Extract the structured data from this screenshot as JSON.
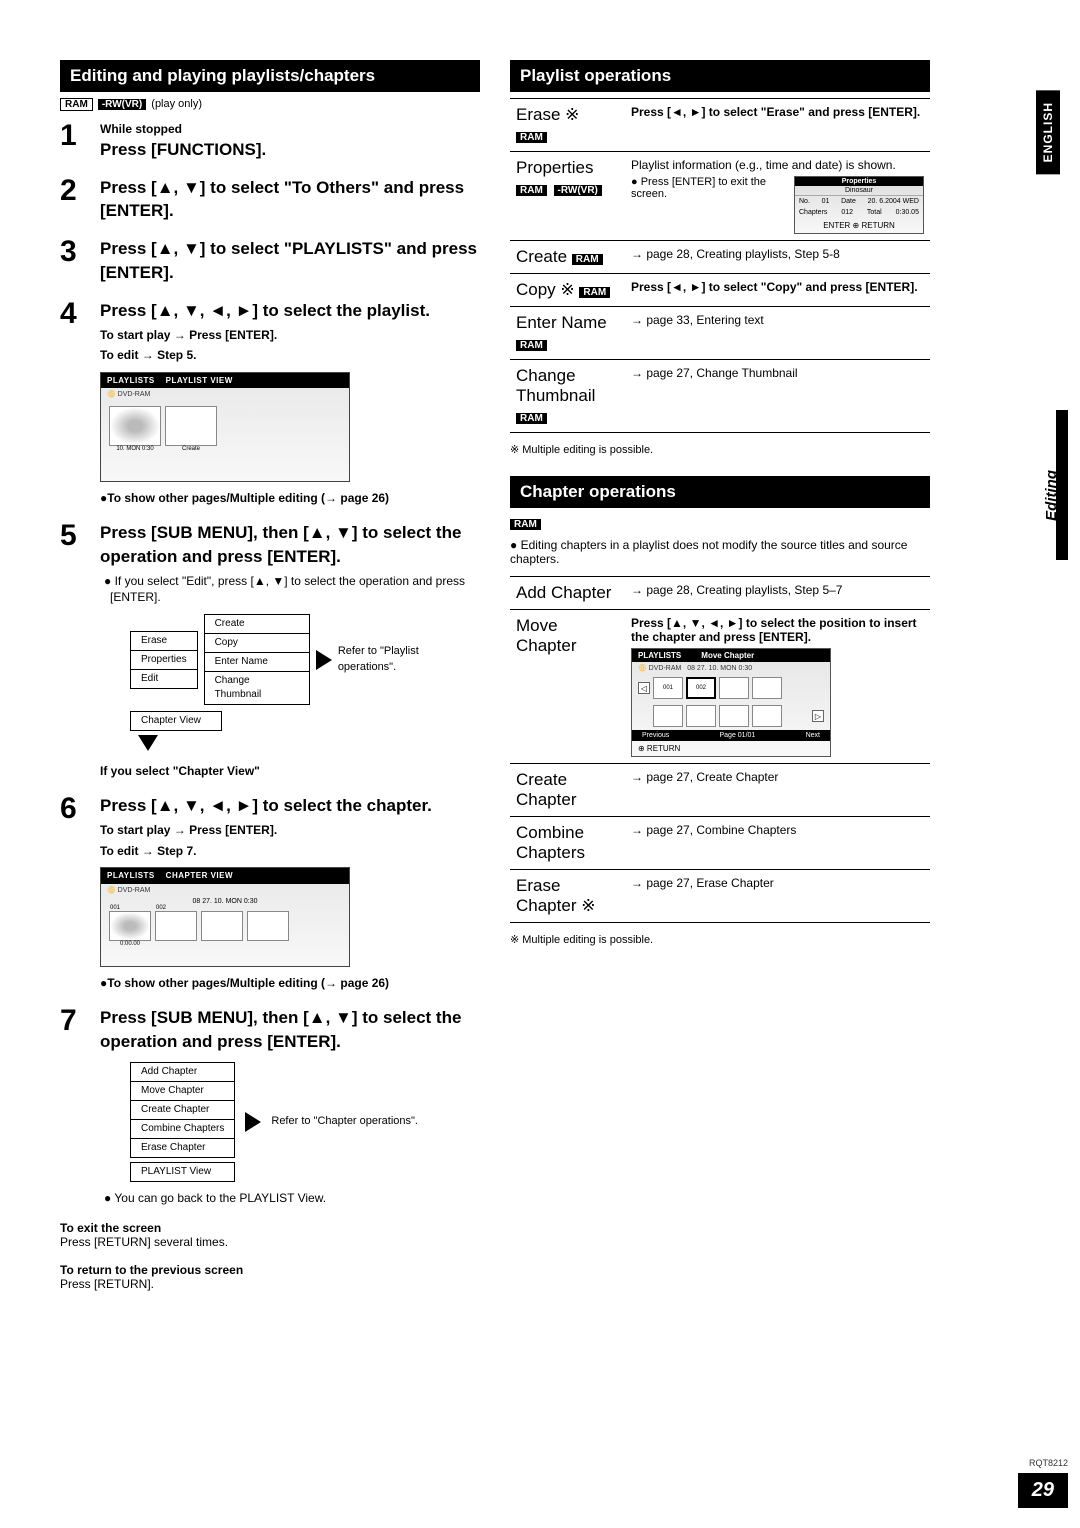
{
  "headers": {
    "left": "Editing and playing playlists/chapters",
    "right_top": "Playlist operations",
    "right_bottom": "Chapter operations"
  },
  "disc_tags_left": {
    "ram": "RAM",
    "rwvr": "-RW(VR)",
    "play_only": "(play only)"
  },
  "steps": {
    "s1_sub": "While stopped",
    "s1": "Press [FUNCTIONS].",
    "s2": "Press [▲, ▼] to select \"To Others\" and press [ENTER].",
    "s3": "Press [▲, ▼] to select \"PLAYLISTS\" and press [ENTER].",
    "s4": "Press [▲, ▼, ◄, ►] to select the playlist.",
    "s4_sub1": "To start play → Press [ENTER].",
    "s4_sub2": "To edit → Step 5.",
    "s4_note": "●To show other pages/Multiple editing (→ page 26)",
    "s5": "Press [SUB MENU], then [▲, ▼] to select the operation and press [ENTER].",
    "s5_note": "● If you select \"Edit\", press [▲, ▼] to select the operation and press [ENTER].",
    "s5_chapter_note": "If you select \"Chapter View\"",
    "s6": "Press [▲, ▼, ◄, ►] to select the chapter.",
    "s6_sub1": "To start play → Press [ENTER].",
    "s6_sub2": "To edit → Step 7.",
    "s6_note": "●To show other pages/Multiple editing (→ page 26)",
    "s7": "Press [SUB MENU], then [▲, ▼] to select the operation and press [ENTER].",
    "s7_note": "● You can go back to the PLAYLIST View."
  },
  "diagram1": {
    "title_l": "PLAYLISTS",
    "title_r": "PLAYLIST VIEW",
    "sub": "DVD-RAM",
    "thumb_label": "10. MON 0:30",
    "create": "Create"
  },
  "diagram2": {
    "title_l": "PLAYLISTS",
    "title_r": "CHAPTER VIEW",
    "sub": "DVD-RAM",
    "date": "08  27. 10. MON 0:30",
    "t1": "001",
    "t1b": "0:00.00",
    "t2": "002"
  },
  "submenu1": {
    "left": [
      "Erase",
      "Properties",
      "Edit",
      "Chapter View"
    ],
    "right": [
      "Create",
      "Copy",
      "Enter Name",
      "Change Thumbnail"
    ],
    "refer": "Refer to \"Playlist operations\"."
  },
  "submenu2": {
    "items": [
      "Add Chapter",
      "Move Chapter",
      "Create Chapter",
      "Combine Chapters",
      "Erase Chapter",
      "PLAYLIST View"
    ],
    "refer": "Refer to \"Chapter operations\"."
  },
  "exit": {
    "exit_h": "To exit the screen",
    "exit_b": "Press [RETURN] several times.",
    "ret_h": "To return to the previous screen",
    "ret_b": "Press [RETURN]."
  },
  "playlist_ops": {
    "erase": {
      "name": "Erase ※",
      "ram": "RAM",
      "desc": "Press [◄, ►] to select \"Erase\" and press [ENTER]."
    },
    "properties": {
      "name": "Properties",
      "ram": "RAM",
      "rwvr": "-RW(VR)",
      "desc1": "Playlist information (e.g., time and date) is shown.",
      "desc2": "● Press [ENTER] to exit the screen.",
      "props_title": "Properties",
      "props_name": "Dinosaur",
      "props_no_l": "No.",
      "props_no_v": "01",
      "props_ch_l": "Chapters",
      "props_ch_v": "012",
      "props_date_l": "Date",
      "props_date_v": "20. 6.2004 WED",
      "props_total_l": "Total",
      "props_total_v": "0:30.05",
      "props_enter": "ENTER ⊕ RETURN"
    },
    "create": {
      "name": "Create",
      "ram": "RAM",
      "desc": "→ page 28, Creating playlists, Step 5-8"
    },
    "copy": {
      "name": "Copy ※",
      "ram": "RAM",
      "desc": "Press [◄, ►] to select \"Copy\" and press [ENTER]."
    },
    "entername": {
      "name": "Enter Name",
      "ram": "RAM",
      "desc": "→ page 33, Entering text"
    },
    "thumbnail": {
      "name": "Change Thumbnail",
      "ram": "RAM",
      "desc": "→ page 27, Change Thumbnail"
    },
    "footnote": "※ Multiple editing is possible."
  },
  "chapter_ops": {
    "ram": "RAM",
    "intro": "● Editing chapters in a playlist does not modify the source titles and source chapters.",
    "add": {
      "name": "Add Chapter",
      "desc": "→ page 28, Creating playlists, Step 5–7"
    },
    "move": {
      "name": "Move Chapter",
      "desc": "Press [▲, ▼, ◄, ►] to select the position to insert the chapter and press [ENTER].",
      "box_title_l": "PLAYLISTS",
      "box_title_r": "Move Chapter",
      "box_sub": "DVD-RAM",
      "box_date": "08   27. 10. MON 0:30",
      "t1": "001",
      "t2": "002",
      "prev": "Previous",
      "page": "Page 01/01",
      "next": "Next",
      "return": "⊕ RETURN"
    },
    "create": {
      "name": "Create Chapter",
      "desc": "→ page 27, Create Chapter"
    },
    "combine": {
      "name": "Combine Chapters",
      "desc": "→ page 27, Combine Chapters"
    },
    "erase": {
      "name": "Erase Chapter ※",
      "desc": "→ page 27, Erase Chapter"
    },
    "footnote": "※ Multiple editing is possible."
  },
  "sidebar": {
    "lang": "ENGLISH",
    "section": "Editing",
    "docnum": "RQT8212",
    "pagenum": "29"
  }
}
